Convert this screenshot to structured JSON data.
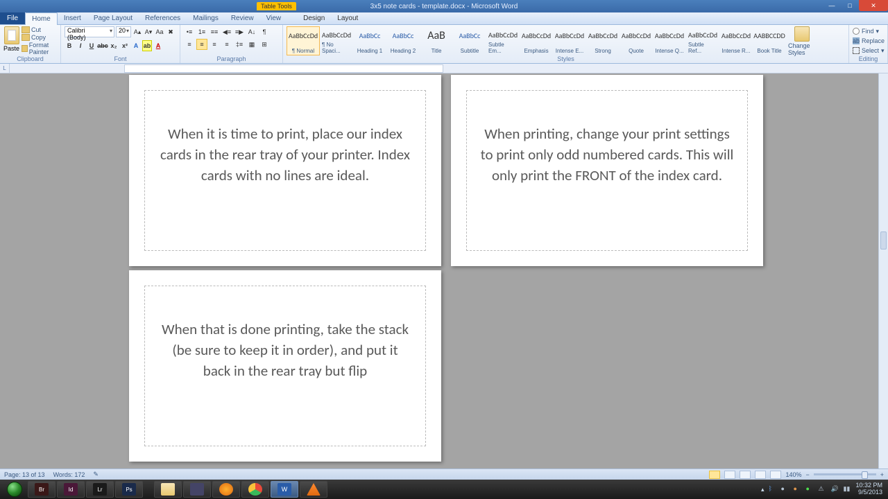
{
  "titlebar": {
    "table_tools": "Table Tools",
    "doc_title": "3x5 note cards - template.docx - Microsoft Word"
  },
  "tabs": {
    "file": "File",
    "home": "Home",
    "insert": "Insert",
    "page_layout": "Page Layout",
    "references": "References",
    "mailings": "Mailings",
    "review": "Review",
    "view": "View",
    "design": "Design",
    "layout": "Layout"
  },
  "ribbon": {
    "clipboard": {
      "label": "Clipboard",
      "paste": "Paste",
      "cut": "Cut",
      "copy": "Copy",
      "format_painter": "Format Painter"
    },
    "font": {
      "label": "Font",
      "name": "Calibri (Body)",
      "size": "20"
    },
    "paragraph": {
      "label": "Paragraph"
    },
    "styles": {
      "label": "Styles",
      "items": [
        {
          "preview": "AaBbCcDd",
          "name": "¶ Normal",
          "cls": ""
        },
        {
          "preview": "AaBbCcDd",
          "name": "¶ No Spaci...",
          "cls": ""
        },
        {
          "preview": "AaBbCc",
          "name": "Heading 1",
          "cls": "blue"
        },
        {
          "preview": "AaBbCc",
          "name": "Heading 2",
          "cls": "blue"
        },
        {
          "preview": "AaB",
          "name": "Title",
          "cls": "big"
        },
        {
          "preview": "AaBbCc",
          "name": "Subtitle",
          "cls": "blue"
        },
        {
          "preview": "AaBbCcDd",
          "name": "Subtle Em...",
          "cls": ""
        },
        {
          "preview": "AaBbCcDd",
          "name": "Emphasis",
          "cls": ""
        },
        {
          "preview": "AaBbCcDd",
          "name": "Intense E...",
          "cls": ""
        },
        {
          "preview": "AaBbCcDd",
          "name": "Strong",
          "cls": ""
        },
        {
          "preview": "AaBbCcDd",
          "name": "Quote",
          "cls": ""
        },
        {
          "preview": "AaBbCcDd",
          "name": "Intense Q...",
          "cls": ""
        },
        {
          "preview": "AaBbCcDd",
          "name": "Subtle Ref...",
          "cls": ""
        },
        {
          "preview": "AaBbCcDd",
          "name": "Intense R...",
          "cls": ""
        },
        {
          "preview": "AABBCCDD",
          "name": "Book Title",
          "cls": ""
        }
      ],
      "change_styles": "Change Styles"
    },
    "editing": {
      "label": "Editing",
      "find": "Find",
      "replace": "Replace",
      "select": "Select"
    }
  },
  "cards": {
    "c1": "When it is time to print, place our index cards in the rear tray of your printer.  Index cards with no lines are ideal.",
    "c2": "When printing, change your print settings to print only odd numbered cards.  This will only print the FRONT of the index card.",
    "c3": "When that is done printing, take the stack (be sure to keep it in order), and put it back in the rear tray but flip"
  },
  "status": {
    "page": "Page: 13 of 13",
    "words": "Words: 172",
    "zoom": "140%"
  },
  "taskbar": {
    "apps": [
      "Br",
      "Id",
      "Lr",
      "Ps"
    ],
    "time": "10:32 PM",
    "date": "9/5/2013"
  }
}
